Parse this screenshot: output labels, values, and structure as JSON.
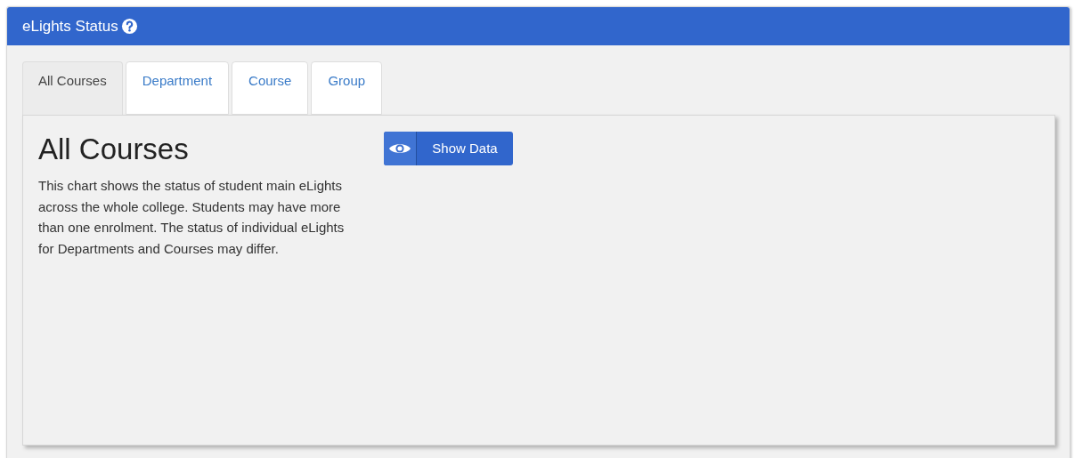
{
  "panel": {
    "title": "eLights Status"
  },
  "tabs": [
    {
      "label": "All Courses",
      "selected": true
    },
    {
      "label": "Department",
      "selected": false
    },
    {
      "label": "Course",
      "selected": false
    },
    {
      "label": "Group",
      "selected": false
    }
  ],
  "content": {
    "heading": "All Courses",
    "description": "This chart shows the status of student main eLights across the whole college. Students may have more than one enrolment. The status of individual eLights for Departments and Courses may differ.",
    "button": "Show Data"
  }
}
